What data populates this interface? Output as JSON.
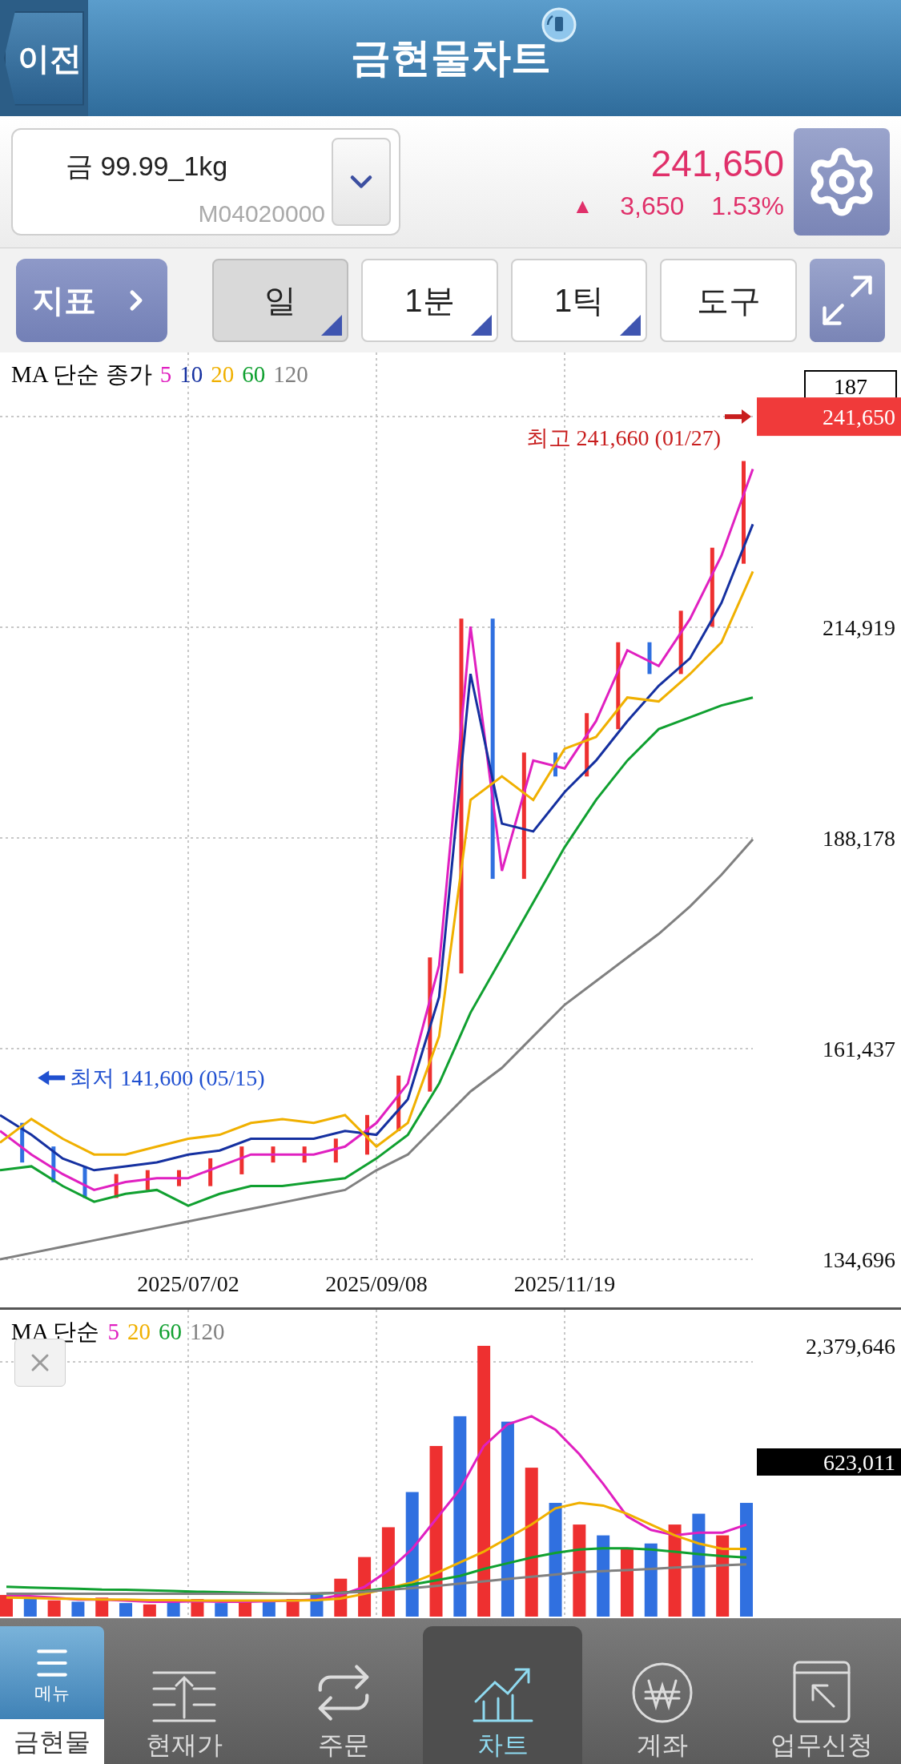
{
  "header": {
    "back": "이전",
    "title": "금현물차트"
  },
  "instrument": {
    "name": "금 99.99_1kg",
    "code": "M04020000",
    "price": "241,650",
    "change_sign": "▲",
    "change": "3,650",
    "change_pct": "1.53%"
  },
  "toolbar": {
    "indicator": "지표",
    "buttons": [
      {
        "label": "일",
        "selected": true,
        "has_menu": true
      },
      {
        "label": "1분",
        "selected": false,
        "has_menu": true
      },
      {
        "label": "1틱",
        "selected": false,
        "has_menu": true
      },
      {
        "label": "도구",
        "selected": false,
        "has_menu": false
      }
    ]
  },
  "price_chart": {
    "legend_title": "MA 단순 종가",
    "count": "187",
    "current_price": "241,650",
    "chart_data": {
      "type": "line",
      "grid": true,
      "ylim": [
        134696,
        249796
      ],
      "categories": [
        null,
        null,
        null,
        null,
        null,
        null,
        "2025/07/02",
        null,
        null,
        null,
        null,
        null,
        "2025/09/08",
        null,
        null,
        null,
        null,
        null,
        "2025/11/19",
        null,
        null,
        null,
        null,
        null,
        null
      ],
      "yticks": [
        {
          "value": 134696,
          "label": "134,696"
        },
        {
          "value": 161437,
          "label": "161,437"
        },
        {
          "value": 188178,
          "label": "188,178"
        },
        {
          "value": 214919,
          "label": "214,919"
        }
      ],
      "series": [
        {
          "name": "5",
          "color": "#e020c0",
          "values": [
            151000,
            148000,
            145500,
            143500,
            144500,
            145000,
            145000,
            146500,
            148000,
            148000,
            148000,
            149000,
            152000,
            157000,
            172000,
            215000,
            184000,
            198000,
            197000,
            203000,
            212000,
            210000,
            216000,
            224000,
            235000
          ]
        },
        {
          "name": "10",
          "color": "#1530a0",
          "values": [
            153000,
            150500,
            147500,
            146000,
            146500,
            147000,
            148000,
            148500,
            150000,
            150000,
            150000,
            151000,
            150500,
            155000,
            168000,
            209000,
            190000,
            189000,
            194000,
            198000,
            203000,
            207500,
            211000,
            218000,
            228000
          ]
        },
        {
          "name": "20",
          "color": "#f0b000",
          "values": [
            149500,
            152500,
            150000,
            148000,
            148000,
            149000,
            150000,
            150500,
            152000,
            152500,
            152000,
            153000,
            149000,
            152000,
            163000,
            193000,
            196000,
            193000,
            199500,
            201000,
            206000,
            205500,
            209000,
            213000,
            222000
          ]
        },
        {
          "name": "60",
          "color": "#10a030",
          "values": [
            146000,
            146500,
            144000,
            142000,
            143000,
            143500,
            141500,
            143000,
            144000,
            144000,
            144500,
            145000,
            147500,
            150500,
            157000,
            166000,
            173000,
            180000,
            187000,
            193000,
            198000,
            202000,
            203500,
            205000,
            206000
          ]
        },
        {
          "name": "120",
          "color": "#808080",
          "values": [
            134700,
            135500,
            136300,
            137100,
            137900,
            138700,
            139500,
            140300,
            141100,
            141900,
            142700,
            143500,
            146000,
            148000,
            152000,
            156000,
            159000,
            163000,
            167000,
            170000,
            173000,
            176000,
            179500,
            183500,
            188000
          ]
        }
      ],
      "annotations": [
        "최고 241,660 (01/27)",
        "최저 141,600 (05/15)"
      ]
    }
  },
  "volume_chart": {
    "legend_title": "MA 단순",
    "current_value": "623,011",
    "max_label": "2,379,646",
    "legend": [
      {
        "label": "5",
        "color": "#e020c0"
      },
      {
        "label": "20",
        "color": "#f0b000"
      },
      {
        "label": "60",
        "color": "#10a030"
      },
      {
        "label": "120",
        "color": "#808080"
      }
    ]
  },
  "nav": {
    "menu_label": "메뉴",
    "items": [
      {
        "kind": "menu",
        "label": "금현물",
        "selected": false
      },
      {
        "kind": "quote",
        "label": "현재가",
        "selected": false
      },
      {
        "kind": "order",
        "label": "주문",
        "selected": false
      },
      {
        "kind": "chart",
        "label": "차트",
        "selected": true
      },
      {
        "kind": "account",
        "label": "계좌",
        "selected": false
      },
      {
        "kind": "request",
        "label": "업무신청",
        "selected": false
      }
    ]
  }
}
